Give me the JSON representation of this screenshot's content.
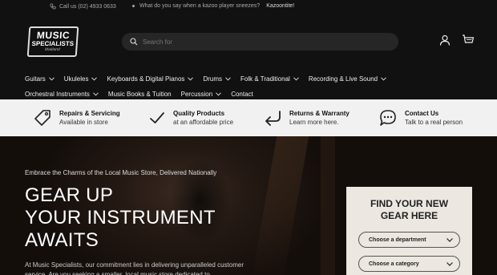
{
  "topbar": {
    "phone": "Call us (02) 4933 0633",
    "joke_question": "What do you say when a kazoo player sneezes?",
    "joke_answer": "Kazoontite!"
  },
  "logo": {
    "line1": "MUSIC",
    "line2": "SPECIALISTS",
    "line3": "Maitland"
  },
  "search": {
    "placeholder": "Search for"
  },
  "nav": {
    "row1": [
      {
        "label": "Guitars"
      },
      {
        "label": "Ukuleles"
      },
      {
        "label": "Keyboards & Digital Pianos"
      },
      {
        "label": "Drums"
      },
      {
        "label": "Folk & Traditional"
      },
      {
        "label": "Recording & Live Sound"
      }
    ],
    "row2": [
      {
        "label": "Orchestral Instruments"
      },
      {
        "label": "Music Books & Tuition"
      },
      {
        "label": "Percussion"
      },
      {
        "label": "Contact"
      }
    ]
  },
  "features": [
    {
      "title": "Repairs & Servicing",
      "subtitle": "Available in store",
      "icon": "tag-icon"
    },
    {
      "title": "Quality Products",
      "subtitle": "at an affordable price",
      "icon": "checkmark-icon"
    },
    {
      "title": "Returns & Warranty",
      "subtitle": "Learn more here.",
      "icon": "return-arrow-icon"
    },
    {
      "title": "Contact Us",
      "subtitle": "Talk to a real person",
      "icon": "chat-bubble-icon"
    }
  ],
  "hero": {
    "tagline": "Embrace the Charms of the Local Music Store, Delivered Nationally",
    "heading_line1": "GEAR UP",
    "heading_line2": "YOUR INSTRUMENT",
    "heading_line3": "AWAITS",
    "description": "At Music Specialists, our commitment lies in delivering unparalleled customer service. Are you seeking a smaller, local music store dedicated to"
  },
  "finder": {
    "title_line1": "FIND YOUR NEW",
    "title_line2": "GEAR HERE",
    "department_placeholder": "Choose a department",
    "category_placeholder": "Choose a category"
  },
  "colors": {
    "background": "#111111",
    "feature_bar": "#f1f1f1",
    "finder_panel": "#ece7e0"
  }
}
